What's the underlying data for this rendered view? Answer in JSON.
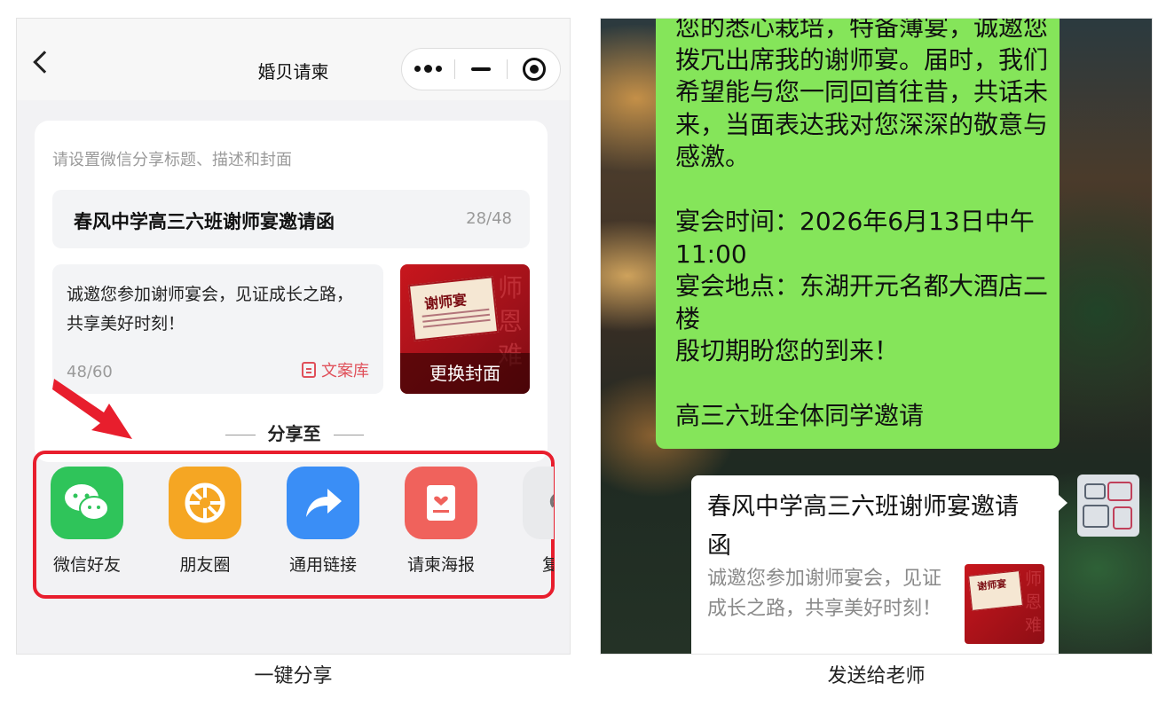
{
  "left_panel": {
    "nav": {
      "title": "婚贝请柬"
    },
    "form": {
      "hint": "请设置微信分享标题、描述和封面",
      "share_title": "春风中学高三六班谢师宴邀请函",
      "title_count": "28/48",
      "share_desc": "诚邀您参加谢师宴会，见证成长之路，共享美好时刻！",
      "desc_count": "48/60",
      "copy_library_label": "文案库",
      "cover_heading": "谢师宴",
      "cover_side_text": "师恩难",
      "change_cover_label": "更换封面"
    },
    "share_to_label": "分享至",
    "share_options": [
      {
        "label": "微信好友",
        "icon": "wechat-icon",
        "color": "#2fc45a"
      },
      {
        "label": "朋友圈",
        "icon": "moments-icon",
        "color": "#f5a623"
      },
      {
        "label": "通用链接",
        "icon": "share-arrow-icon",
        "color": "#3a8ef6"
      },
      {
        "label": "请柬海报",
        "icon": "poster-icon",
        "color": "#f0625c"
      },
      {
        "label": "复制",
        "icon": "copy-icon",
        "color": "#e9eaec"
      }
    ],
    "caption": "一键分享"
  },
  "right_panel": {
    "message_text": "您的悉心栽培，特备薄宴，诚邀您拨冗出席我的谢师宴。届时，我们希望能与您一同回首往昔，共话未来，当面表达我对您深深的敬意与感激。\n\n宴会时间：2026年6月13日中午11:00\n宴会地点：东湖开元名都大酒店二楼\n殷切期盼您的到来！\n\n高三六班全体同学邀请",
    "link_card": {
      "title": "春风中学高三六班谢师宴邀请函",
      "desc": "诚邀您参加谢师宴会，见证成长之路，共享美好时刻！",
      "thumb_heading": "谢师宴",
      "thumb_side_text": "师恩难"
    },
    "caption": "发送给老师"
  },
  "colors": {
    "chat_bubble": "#85e55a",
    "highlight_border": "#e81e2d",
    "accent_red": "#e0505a"
  }
}
